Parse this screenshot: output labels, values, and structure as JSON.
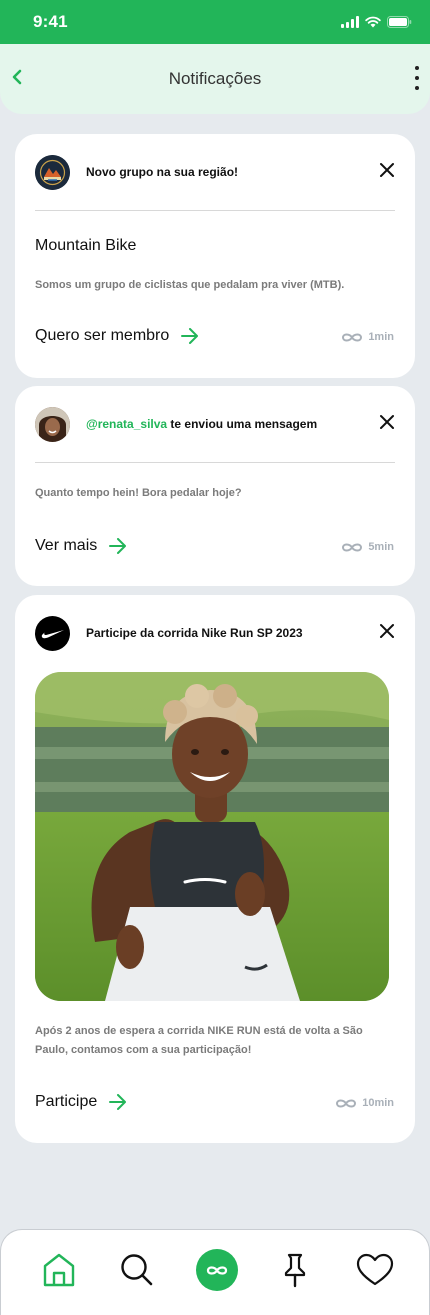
{
  "status_bar": {
    "time": "9:41"
  },
  "header": {
    "title": "Notificações"
  },
  "notifications": [
    {
      "header": "Novo grupo na sua região!",
      "title": "Mountain Bike",
      "description": "Somos um grupo de ciclistas que pedalam pra viver (MTB).",
      "cta": "Quero ser membro",
      "time": "1min"
    },
    {
      "handle": "@renata_silva",
      "header_rest": " te enviou uma mensagem",
      "description": "Quanto tempo hein! Bora pedalar hoje?",
      "cta": "Ver mais",
      "time": "5min"
    },
    {
      "header": "Participe da corrida Nike Run SP 2023",
      "description": "Após 2 anos de espera a corrida NIKE RUN está de volta a São Paulo, contamos com a sua participação!",
      "cta": "Participe",
      "time": "10min"
    }
  ],
  "tab_bar": {
    "items": [
      "home-icon",
      "search-icon",
      "infinity-icon",
      "pin-icon",
      "heart-icon"
    ],
    "active": "infinity-icon"
  },
  "colors": {
    "accent": "#22b559",
    "header_bg": "#e4f6ec",
    "page_bg": "#e6eaee",
    "muted_text": "#7b7b7b",
    "time_text": "#a9b0b8"
  }
}
